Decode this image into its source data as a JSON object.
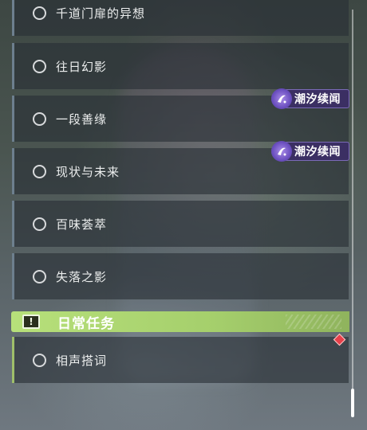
{
  "quests": [
    {
      "label": "千道门扉的异想",
      "tag": null
    },
    {
      "label": "往日幻影",
      "tag": null
    },
    {
      "label": "一段善缘",
      "tag": "潮汐续闻"
    },
    {
      "label": "现状与未来",
      "tag": "潮汐续闻"
    },
    {
      "label": "百味荟萃",
      "tag": null
    },
    {
      "label": "失落之影",
      "tag": null
    }
  ],
  "daily_section": {
    "title": "日常任务",
    "icon": "exclamation-icon"
  },
  "daily_quests": [
    {
      "label": "相声搭词",
      "marker": "red-diamond-icon"
    }
  ],
  "colors": {
    "daily_header": "#b7e07a",
    "tag_bg": "#3b2f63",
    "marker": "#e8404a"
  }
}
